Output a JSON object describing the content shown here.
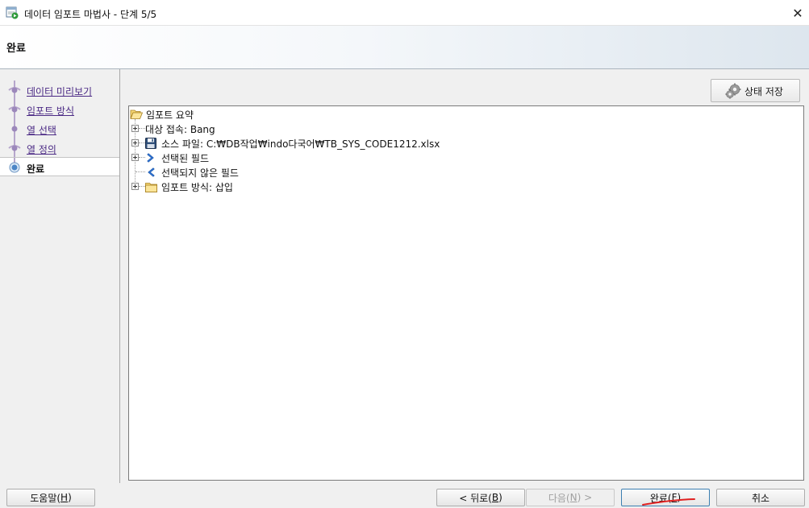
{
  "window": {
    "title": "데이터 임포트 마법사 - 단계 5/5",
    "close_glyph": "✕"
  },
  "header": {
    "title": "완료"
  },
  "steps": [
    {
      "label": "데이터 미리보기",
      "state": "done"
    },
    {
      "label": "임포트 방식",
      "state": "done"
    },
    {
      "label": "열 선택",
      "state": "done"
    },
    {
      "label": "열 정의",
      "state": "done"
    },
    {
      "label": "완료",
      "state": "current"
    }
  ],
  "toolbar": {
    "save_state_label": "상태 저장"
  },
  "summary_tree": {
    "root": {
      "label": "임포트 요약",
      "icon": "folder-open-icon"
    },
    "children": [
      {
        "label": "대상 접속: Bang",
        "icon": "none",
        "expandable": true
      },
      {
        "label": "소스 파일: C:₩DB작업₩indo다국어₩TB_SYS_CODE1212.xlsx",
        "icon": "floppy-disk-icon",
        "expandable": true
      },
      {
        "label": "선택된 필드",
        "icon": "chevron-right-icon",
        "expandable": true
      },
      {
        "label": "선택되지 않은 필드",
        "icon": "chevron-left-icon",
        "expandable": false
      },
      {
        "label": "임포트 방식: 삽입",
        "icon": "folder-icon",
        "expandable": true
      }
    ]
  },
  "footer": {
    "help": {
      "label": "도움말(",
      "mnemonic": "H",
      "suffix": ")"
    },
    "back": {
      "label": "< 뒤로(",
      "mnemonic": "B",
      "suffix": ")"
    },
    "next": {
      "label": "다음(",
      "mnemonic": "N",
      "suffix": ") >"
    },
    "finish": {
      "label": "완료(",
      "mnemonic": "F",
      "suffix": ")"
    },
    "cancel": {
      "label": "취소"
    }
  },
  "colors": {
    "step_link": "#4b2a85",
    "annotation_red": "#e02020",
    "primary_border": "#3c7fb1"
  }
}
